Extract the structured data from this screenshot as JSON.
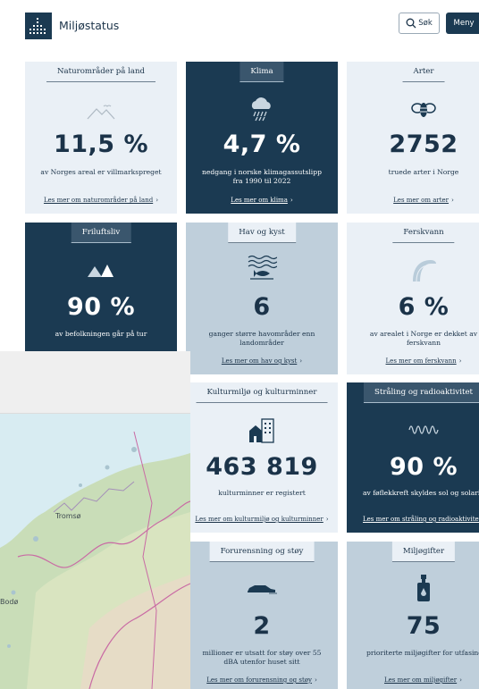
{
  "header": {
    "brand": "Miljøstatus",
    "search_label": "Søk",
    "menu_label": "Meny"
  },
  "cards": [
    {
      "id": "naturomrader",
      "tag": "Naturområder på land",
      "value": "11,5 %",
      "desc": "av Norges areal er villmarkspreget",
      "link": "Les mer om naturområder på land",
      "theme": "light",
      "icon": "mountains-icon"
    },
    {
      "id": "klima",
      "tag": "Klima",
      "value": "4,7 %",
      "desc": "nedgang i norske klimagassutslipp fra 1990 til 2022",
      "link": "Les mer om klima",
      "theme": "dark",
      "icon": "rain-cloud-icon"
    },
    {
      "id": "arter",
      "tag": "Arter",
      "value": "2752",
      "desc": "truede arter i Norge",
      "link": "Les mer om arter",
      "theme": "light",
      "icon": "bee-icon"
    },
    {
      "id": "friluftsliv",
      "tag": "Friluftsliv",
      "value": "90 %",
      "desc": "av befolkningen går på tur",
      "link": "",
      "theme": "dark",
      "icon": "tents-icon"
    },
    {
      "id": "hav",
      "tag": "Hav og kyst",
      "value": "6",
      "desc": "ganger større havområder enn landområder",
      "link": "Les mer om hav og kyst",
      "theme": "mid",
      "icon": "fish-waves-icon"
    },
    {
      "id": "ferskvann",
      "tag": "Ferskvann",
      "value": "6 %",
      "desc": "av arealet i Norge er dekket av ferskvann",
      "link": "Les mer om ferskvann",
      "theme": "light",
      "icon": "waterfall-icon"
    },
    {
      "id": "kulturmiljo",
      "tag": "Kulturmiljø og kulturminner",
      "value": "463 819",
      "desc": "kulturminner er registert",
      "link": "Les mer om kulturmiljø og kulturminner",
      "theme": "light",
      "icon": "buildings-icon"
    },
    {
      "id": "straling",
      "tag": "Stråling og radioaktivitet",
      "value": "90 %",
      "desc": "av føflekkreft skyldes sol og solarier",
      "link": "Les mer om stråling og radioaktivitet",
      "theme": "dark",
      "icon": "radiation-wave-icon"
    },
    {
      "id": "forurensning",
      "tag": "Forurensning og støy",
      "value": "2",
      "desc": "millioner er utsatt for støy over 55 dBA utenfor huset sitt",
      "link": "Les mer om forurensning og støy",
      "theme": "mid",
      "icon": "car-icon"
    },
    {
      "id": "miljogifter",
      "tag": "Miljøgifter",
      "value": "75",
      "desc": "prioriterte miljøgifter for utfasing",
      "link": "Les mer om miljøgifter",
      "theme": "mid",
      "icon": "spray-bottle-icon"
    }
  ],
  "map": {
    "labels": [
      "Tromsø",
      "Bodø"
    ]
  },
  "colors": {
    "dark": "#1b3a52",
    "light": "#eaf0f6",
    "mid": "#bfcfdb"
  }
}
